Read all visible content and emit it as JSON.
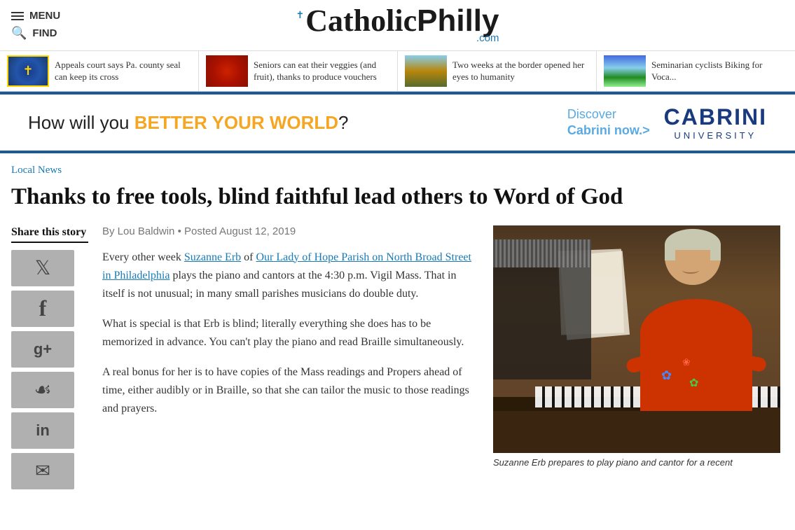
{
  "header": {
    "menu_label": "MENU",
    "find_label": "FIND",
    "logo_catholic": "Catholic",
    "logo_philly": "Philly",
    "logo_dot_com": ".com"
  },
  "top_stories": [
    {
      "text": "Appeals court says Pa. county seal can keep its cross",
      "thumb_type": "seal"
    },
    {
      "text": "Seniors can eat their veggies (and fruit), thanks to produce vouchers",
      "thumb_type": "berries"
    },
    {
      "text": "Two weeks at the border opened her eyes to humanity",
      "thumb_type": "border"
    },
    {
      "text": "Seminarian cyclists Biking for Voca...",
      "thumb_type": "cyclists"
    }
  ],
  "ad": {
    "text_prefix": "How will you ",
    "text_highlight": "BETTER YOUR WORLD",
    "text_suffix": "?",
    "discover": "Discover\nCabrini now.>",
    "cabrini": "CABRINI",
    "university": "UNIVERSITY"
  },
  "breadcrumb": "Local News",
  "article": {
    "title": "Thanks to free tools, blind faithful lead others to Word of God",
    "byline": "By Lou Baldwin • Posted August 12, 2019",
    "paragraphs": [
      "Every other week Suzanne Erb of Our Lady of Hope Parish on North Broad Street in Philadelphia plays the piano and cantors at the 4:30 p.m. Vigil Mass. That in itself is not unusual; in many small parishes musicians do double duty.",
      "What is special is that Erb is blind; literally everything she does has to be memorized in advance. You can't play the piano and read Braille simultaneously.",
      "A real bonus for her is to have copies of the Mass readings and Propers ahead of time, either audibly or in Braille, so that she can tailor the music to those readings and prayers."
    ],
    "image_caption": "Suzanne Erb prepares to play piano and cantor for a recent"
  },
  "share": {
    "title": "Share this story",
    "buttons": [
      {
        "label": "Twitter",
        "icon": "𝕏"
      },
      {
        "label": "Facebook",
        "icon": "f"
      },
      {
        "label": "Google Plus",
        "icon": "g+"
      },
      {
        "label": "Pinterest",
        "icon": "𝕡"
      },
      {
        "label": "LinkedIn",
        "icon": "in"
      },
      {
        "label": "Email",
        "icon": "✉"
      }
    ]
  }
}
